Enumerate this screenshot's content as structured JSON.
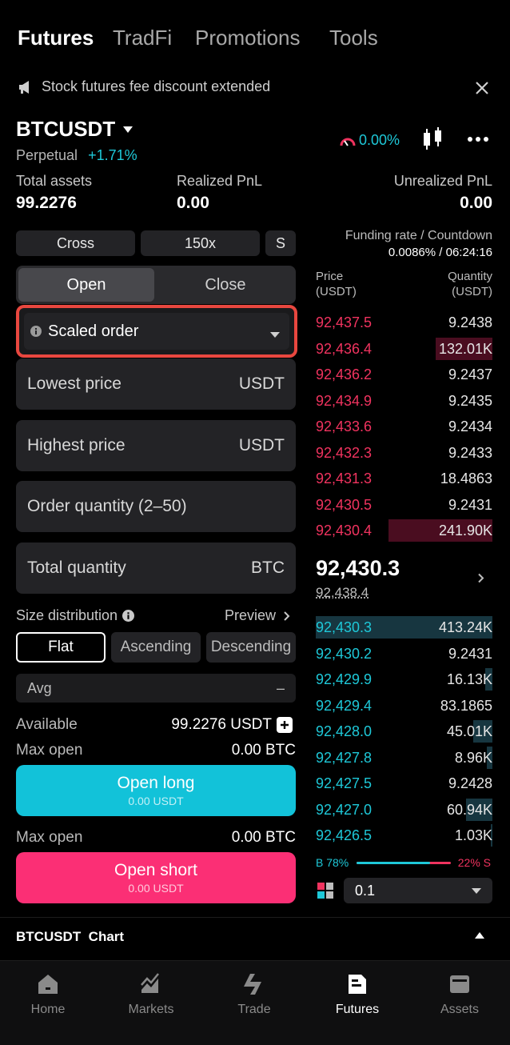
{
  "top_tabs": [
    "Futures",
    "TradFi",
    "Promotions",
    "Tools"
  ],
  "notice": {
    "text": "Stock futures fee discount extended"
  },
  "symbol": {
    "name": "BTCUSDT",
    "type": "Perpetual",
    "change": "+1.71%",
    "gauge": "0.00%"
  },
  "assets": {
    "total_label": "Total assets",
    "total_value": "99.2276",
    "realized_label": "Realized PnL",
    "realized_value": "0.00",
    "unrealized_label": "Unrealized PnL",
    "unrealized_value": "0.00"
  },
  "margin": {
    "mode": "Cross",
    "leverage": "150x",
    "size": "S"
  },
  "funding": {
    "label": "Funding rate / Countdown",
    "value": "0.0086% / 06:24:16"
  },
  "open_close": {
    "open": "Open",
    "close": "Close"
  },
  "order_type": "Scaled order",
  "fields": {
    "lowest_price": "Lowest price",
    "lowest_unit": "USDT",
    "highest_price": "Highest price",
    "highest_unit": "USDT",
    "order_quantity": "Order quantity (2–50)",
    "total_quantity": "Total quantity",
    "total_unit": "BTC"
  },
  "distribution": {
    "label": "Size distribution",
    "preview": "Preview",
    "options": [
      "Flat",
      "Ascending",
      "Descending"
    ],
    "avg_label": "Avg",
    "avg_value": "–"
  },
  "account": {
    "available_label": "Available",
    "available_value": "99.2276 USDT",
    "max_open_label": "Max open",
    "max_open_long": "0.00 BTC",
    "max_open_short": "0.00 BTC"
  },
  "buttons": {
    "long": "Open long",
    "long_sub": "0.00 USDT",
    "short": "Open short",
    "short_sub": "0.00 USDT"
  },
  "orderbook": {
    "price_header": "Price",
    "price_unit": "(USDT)",
    "qty_header": "Quantity",
    "qty_unit": "(USDT)",
    "asks": [
      {
        "price": "92,437.5",
        "qty": "9.2438",
        "depth": 0
      },
      {
        "price": "92,436.4",
        "qty": "132.01K",
        "depth": 0.32
      },
      {
        "price": "92,436.2",
        "qty": "9.2437",
        "depth": 0
      },
      {
        "price": "92,434.9",
        "qty": "9.2435",
        "depth": 0
      },
      {
        "price": "92,433.6",
        "qty": "9.2434",
        "depth": 0
      },
      {
        "price": "92,432.3",
        "qty": "9.2433",
        "depth": 0
      },
      {
        "price": "92,431.3",
        "qty": "18.4863",
        "depth": 0
      },
      {
        "price": "92,430.5",
        "qty": "9.2431",
        "depth": 0
      },
      {
        "price": "92,430.4",
        "qty": "241.90K",
        "depth": 0.59
      }
    ],
    "last_price": "92,430.3",
    "mark_price": "92,438.4",
    "bids": [
      {
        "price": "92,430.3",
        "qty": "413.24K",
        "depth": 1.0
      },
      {
        "price": "92,430.2",
        "qty": "9.2431",
        "depth": 0
      },
      {
        "price": "92,429.9",
        "qty": "16.13K",
        "depth": 0.04
      },
      {
        "price": "92,429.4",
        "qty": "83.1865",
        "depth": 0
      },
      {
        "price": "92,428.0",
        "qty": "45.01K",
        "depth": 0.11
      },
      {
        "price": "92,427.8",
        "qty": "8.96K",
        "depth": 0.03
      },
      {
        "price": "92,427.5",
        "qty": "9.2428",
        "depth": 0
      },
      {
        "price": "92,427.0",
        "qty": "60.94K",
        "depth": 0.15
      },
      {
        "price": "92,426.5",
        "qty": "1.03K",
        "depth": 0.01
      }
    ],
    "buy_ratio": "B 78%",
    "sell_ratio": "22% S",
    "buy_fraction": 0.78,
    "precision": "0.1"
  },
  "chart_section": {
    "title": "BTCUSDT  Chart"
  },
  "nav": [
    "Home",
    "Markets",
    "Trade",
    "Futures",
    "Assets"
  ],
  "colors": {
    "green": "#1ec8d8",
    "red": "#f0335f",
    "long_btn": "#12c2d9",
    "short_btn": "#fb2f75",
    "highlight": "#e8473f"
  }
}
